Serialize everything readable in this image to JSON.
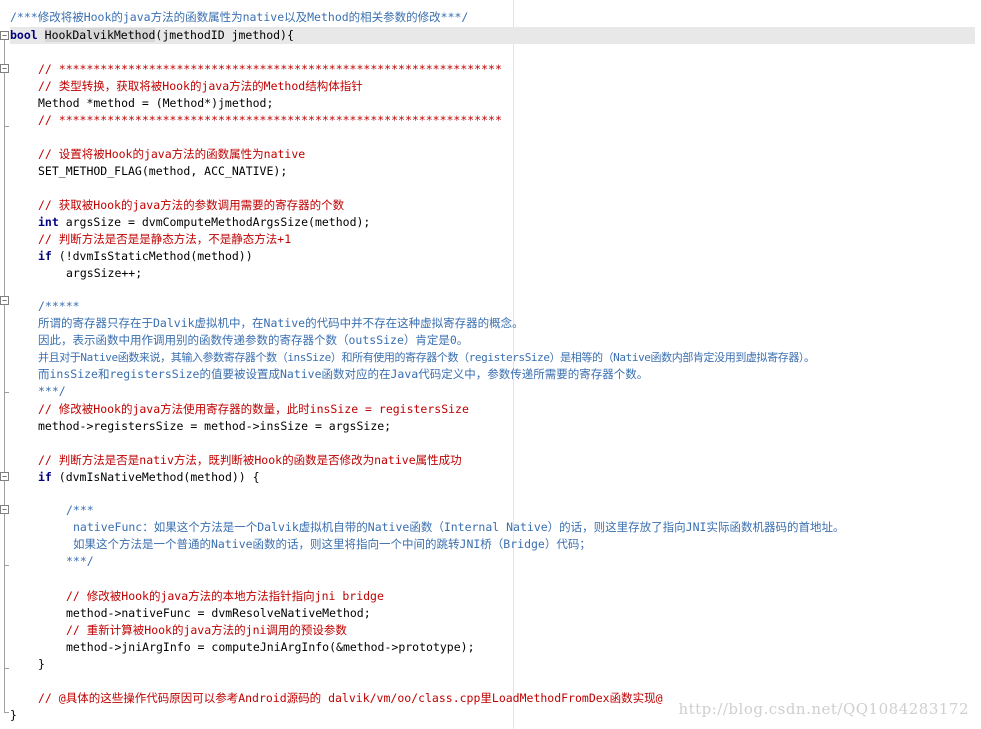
{
  "code": {
    "l01": "/***修改将被Hook的java方法的函数属性为native以及Method的相关参数的修改***/",
    "l02_kw": "bool",
    "l02_fn": "HookDalvikMethod",
    "l02_rest": "(jmethodID jmethod){",
    "l03": "// ****************************************************************",
    "l04": "// 类型转换，获取将被Hook的java方法的Method结构体指针",
    "l05": "Method *method = (Method*)jmethod;",
    "l06": "// ****************************************************************",
    "l07": "// 设置将被Hook的java方法的函数属性为native",
    "l08": "SET_METHOD_FLAG(method, ACC_NATIVE);",
    "l09": "// 获取被Hook的java方法的参数调用需要的寄存器的个数",
    "l10_kw": "int",
    "l10_rest": " argsSize = dvmComputeMethodArgsSize(method);",
    "l11": "// 判断方法是否是是静态方法，不是静态方法+1",
    "l12_kw": "if",
    "l12_rest": " (!dvmIsStaticMethod(method))",
    "l13": "argsSize++;",
    "l14": "/*****",
    "l15": "所谓的寄存器只存在于Dalvik虚拟机中，在Native的代码中并不存在这种虚拟寄存器的概念。",
    "l16": "因此，表示函数中用作调用别的函数传递参数的寄存器个数（outsSize）肯定是0。",
    "l17": "并且对于Native函数来说，其输入参数寄存器个数（insSize）和所有使用的寄存器个数（registersSize）是相等的（Native函数内部肯定没用到虚拟寄存器）。",
    "l18": "而insSize和registersSize的值要被设置成Native函数对应的在Java代码定义中，参数传递所需要的寄存器个数。",
    "l19": "***/",
    "l20": "// 修改被Hook的java方法使用寄存器的数量，此时insSize = registersSize",
    "l21": "method->registersSize = method->insSize = argsSize;",
    "l22": "// 判断方法是否是nativ方法，既判断被Hook的函数是否修改为native属性成功",
    "l23_kw": "if",
    "l23_rest": " (dvmIsNativeMethod(method)) {",
    "l24": "/***",
    "l25": "nativeFunc：如果这个方法是一个Dalvik虚拟机自带的Native函数（Internal Native）的话，则这里存放了指向JNI实际函数机器码的首地址。",
    "l26": "如果这个方法是一个普通的Native函数的话，则这里将指向一个中间的跳转JNI桥（Bridge）代码；",
    "l27": "***/",
    "l28": "// 修改被Hook的java方法的本地方法指针指向jni bridge",
    "l29": "method->nativeFunc = dvmResolveNativeMethod;",
    "l30": "// 重新计算被Hook的java方法的jni调用的预设参数",
    "l31": "method->jniArgInfo = computeJniArgInfo(&method->prototype);",
    "l32": "}",
    "l33": "// @具体的这些操作代码原因可以参考Android源码的 dalvik/vm/oo/class.cpp里LoadMethodFromDex函数实现@",
    "l34": "}"
  },
  "fold_markers": {
    "open": "−"
  },
  "watermark": "http://blog.csdn.net/QQ1084283172",
  "colors": {
    "comment_red": "#c00000",
    "comment_blue": "#3a6fb0",
    "keyword": "#000080"
  }
}
